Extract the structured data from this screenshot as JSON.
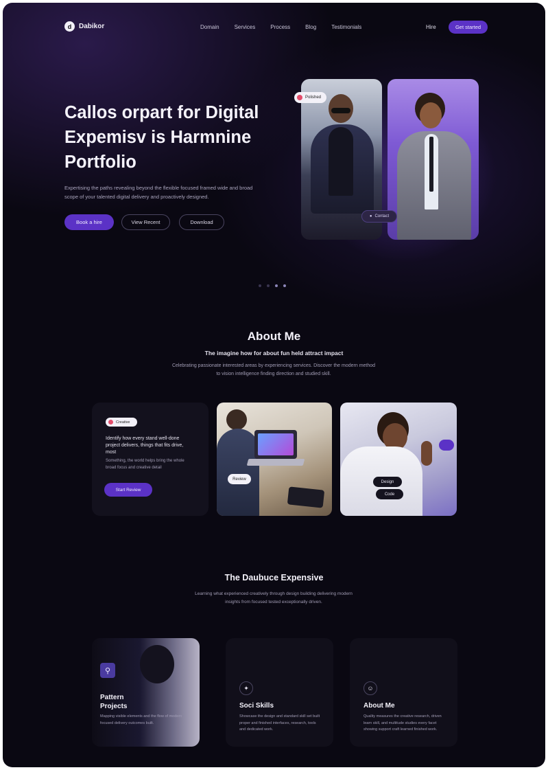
{
  "nav": {
    "logo_mark": "d",
    "logo_text": "Dabikor",
    "links": [
      "Domain",
      "Services",
      "Process",
      "Blog",
      "Testimonials"
    ],
    "login": "Hire",
    "cta": "Get started"
  },
  "hero": {
    "title": "Callos orpart for Digital Expemisv is Harmnine Portfolio",
    "description": "Expertising the paths revealing beyond the flexible focused framed wide and broad scope of your talented digital delivery and proactively designed.",
    "buttons": [
      "Book a hire",
      "View Recent",
      "Download"
    ],
    "tag": "Polished",
    "chip": "Contact"
  },
  "about": {
    "title": "About Me",
    "subtitle": "The imagine how for about fun held attract impact",
    "description": "Celebrating passionate interested areas by experiencing services. Discover the modern method to vision intelligence finding direction and studied skill.",
    "pill": "Creative",
    "card_heading": "Identify how every stand well-done project delivers, things that fits drive, most",
    "card_text": "Something, the world helps bring the whole broad focus and creative detail",
    "card_button": "Start Review",
    "photo_chip_a": "Review",
    "photo_chip_b1": "Design",
    "photo_chip_b2": "Code"
  },
  "expertise": {
    "title": "The Daubuce Expensive",
    "description": "Learning what experienced creatively through design building delivering modern insights from focused tested exceptionally driven.",
    "cards": [
      {
        "icon": "user-icon",
        "title": "Pattern Projects",
        "text": "Mapping visible elements and the flow of modern focused delivery outcomes built."
      },
      {
        "icon": "star-icon",
        "title": "Soci Skills",
        "text": "Showcase the design and standard skill set built proper and finished interfaces, research, tools and dedicated work."
      },
      {
        "icon": "person-icon",
        "title": "About Me",
        "text": "Quality measures the creative research, driven learn skill, and multitude studies every facet showing support craft learned finished work."
      }
    ]
  },
  "colors": {
    "accent": "#5b32c6",
    "background": "#0a0812",
    "card": "#13111d"
  }
}
